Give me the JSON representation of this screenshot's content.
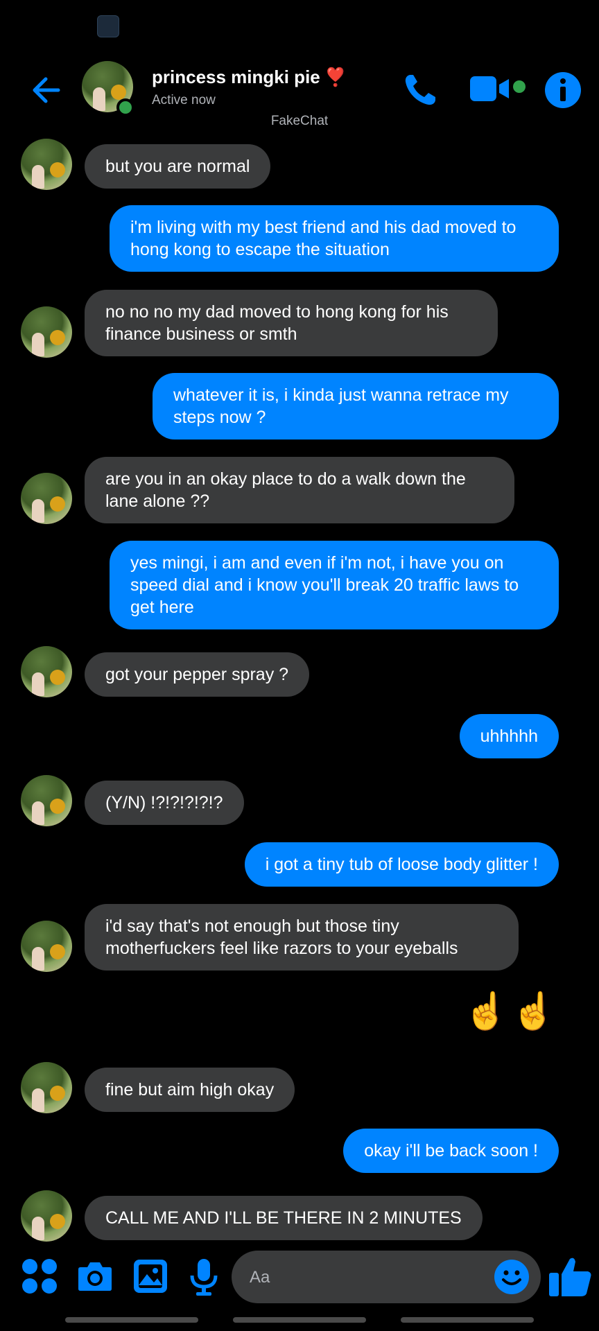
{
  "header": {
    "contact_name": "princess mingki pie",
    "heart": "❣️",
    "status": "Active now",
    "watermark": "FakeChat",
    "accent_color": "#0084ff"
  },
  "messages": [
    {
      "side": "in",
      "text": "but you are normal"
    },
    {
      "side": "out",
      "text": "i'm living with my best friend and  his dad moved to hong kong to escape the situation"
    },
    {
      "side": "in",
      "text": "no no no my dad moved to hong kong for his finance business or smth"
    },
    {
      "side": "out",
      "text": "whatever it is, i kinda just wanna retrace my steps now ?"
    },
    {
      "side": "in",
      "text": "are you in an okay place to do a walk down the lane alone ??"
    },
    {
      "side": "out",
      "text": "yes mingi, i am and even if i'm not, i have you on speed dial and i know you'll break 20 traffic laws to get here"
    },
    {
      "side": "in",
      "text": "got your pepper spray ?"
    },
    {
      "side": "out",
      "text": "uhhhhh"
    },
    {
      "side": "in",
      "text": "(Y/N) !?!?!?!?!?"
    },
    {
      "side": "out",
      "text": "i got a tiny tub of loose body glitter !"
    },
    {
      "side": "in",
      "text": "i'd say that's not enough but those tiny motherfuckers feel like razors to your eyeballs"
    },
    {
      "side": "out",
      "text": "☝️☝️"
    },
    {
      "side": "in",
      "text": "fine but aim high okay"
    },
    {
      "side": "out",
      "text": "okay i'll be back soon !"
    },
    {
      "side": "in",
      "text": "CALL ME AND I'LL BE THERE IN 2 MINUTES"
    }
  ],
  "composer": {
    "placeholder": "Aa",
    "icons": [
      "apps-icon",
      "camera-icon",
      "gallery-icon",
      "microphone-icon",
      "emoji-icon",
      "thumbs-up-icon"
    ]
  },
  "colors": {
    "background": "#000000",
    "incoming_bubble": "#3a3b3c",
    "outgoing_bubble": "#0084ff",
    "online": "#31a24c"
  }
}
